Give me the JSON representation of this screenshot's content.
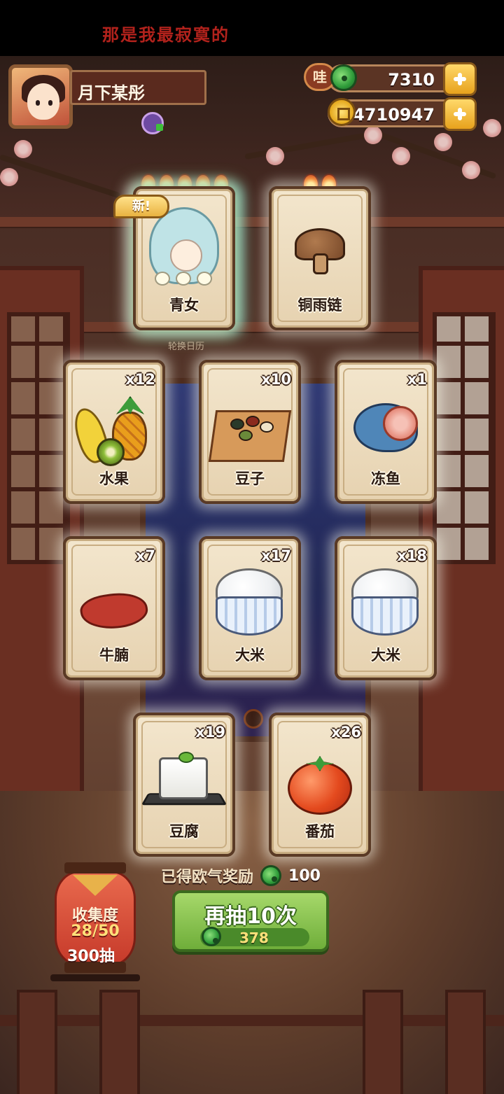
{
  "banner": {
    "marquee": "那是我最寂寞的"
  },
  "player": {
    "name": "月下某彤"
  },
  "currency": {
    "jade": {
      "badge": "哇",
      "value": "7310"
    },
    "coin": {
      "value": "4710947"
    }
  },
  "featured": {
    "new_tag": "新!",
    "caption": "轮换日历",
    "cards": [
      {
        "label": "青女",
        "flames": 5,
        "art": "girl-portrait"
      },
      {
        "label": "铜雨链",
        "flames": 2,
        "art": "mushroom"
      }
    ]
  },
  "items": [
    {
      "label": "水果",
      "count": "x12",
      "art": "fruit"
    },
    {
      "label": "豆子",
      "count": "x10",
      "art": "beans-box"
    },
    {
      "label": "冻鱼",
      "count": "x1",
      "art": "fish"
    },
    {
      "label": "牛腩",
      "count": "x7",
      "art": "meat"
    },
    {
      "label": "大米",
      "count": "x17",
      "art": "rice"
    },
    {
      "label": "大米",
      "count": "x18",
      "art": "rice"
    },
    {
      "label": "豆腐",
      "count": "x19",
      "art": "tofu"
    },
    {
      "label": "番茄",
      "count": "x26",
      "art": "tomato"
    }
  ],
  "reward": {
    "text": "已得欧气奖励",
    "value": "100"
  },
  "collection": {
    "title": "收集度",
    "progress": "28/50",
    "draws": "300抽"
  },
  "draw_button": {
    "label": "再抽10次",
    "cost": "378"
  }
}
